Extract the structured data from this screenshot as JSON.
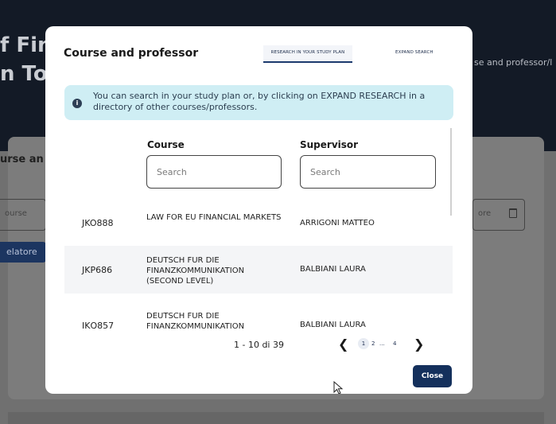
{
  "background": {
    "title_line1": "f Fin",
    "title_line2": "n To",
    "breadcrumb": "se and professor/l",
    "section_label": "urse an",
    "input_left_placeholder": "ourse",
    "input_right_placeholder": "ore",
    "button_left_label": "elatore"
  },
  "modal": {
    "title": "Course and professor",
    "tabs": [
      {
        "label": "RESEARCH IN YOUR STUDY PLAN",
        "active": true
      },
      {
        "label": "EXPAND SEARCH",
        "active": false
      }
    ],
    "info_text": "You can search in your study plan or, by clicking on EXPAND RESEARCH in a directory of other courses/professors.",
    "info_icon": "info-icon",
    "columns": {
      "course": "Course",
      "supervisor": "Supervisor"
    },
    "search": {
      "course_placeholder": "Search",
      "supervisor_placeholder": "Search"
    },
    "rows": [
      {
        "code": "JKO888",
        "course": "LAW FOR EU FINANCIAL MARKETS",
        "supervisor": "ARRIGONI MATTEO"
      },
      {
        "code": "JKP686",
        "course": "DEUTSCH FUR DIE FINANZKOMMUNIKATION (SECOND LEVEL)",
        "supervisor": "BALBIANI LAURA"
      },
      {
        "code": "JKQ857",
        "course": "DEUTSCH FUR DIE FINANZKOMMUNIKATION",
        "supervisor": "BALBIANI LAURA"
      }
    ],
    "pagination": {
      "label": "1 - 10 di 39",
      "pages": [
        "1",
        "2",
        "...",
        "4"
      ],
      "current": "1"
    },
    "close_label": "Close"
  },
  "colors": {
    "header_bg": "#131a26",
    "info_bg": "#cfeef4",
    "primary": "#14305c"
  }
}
